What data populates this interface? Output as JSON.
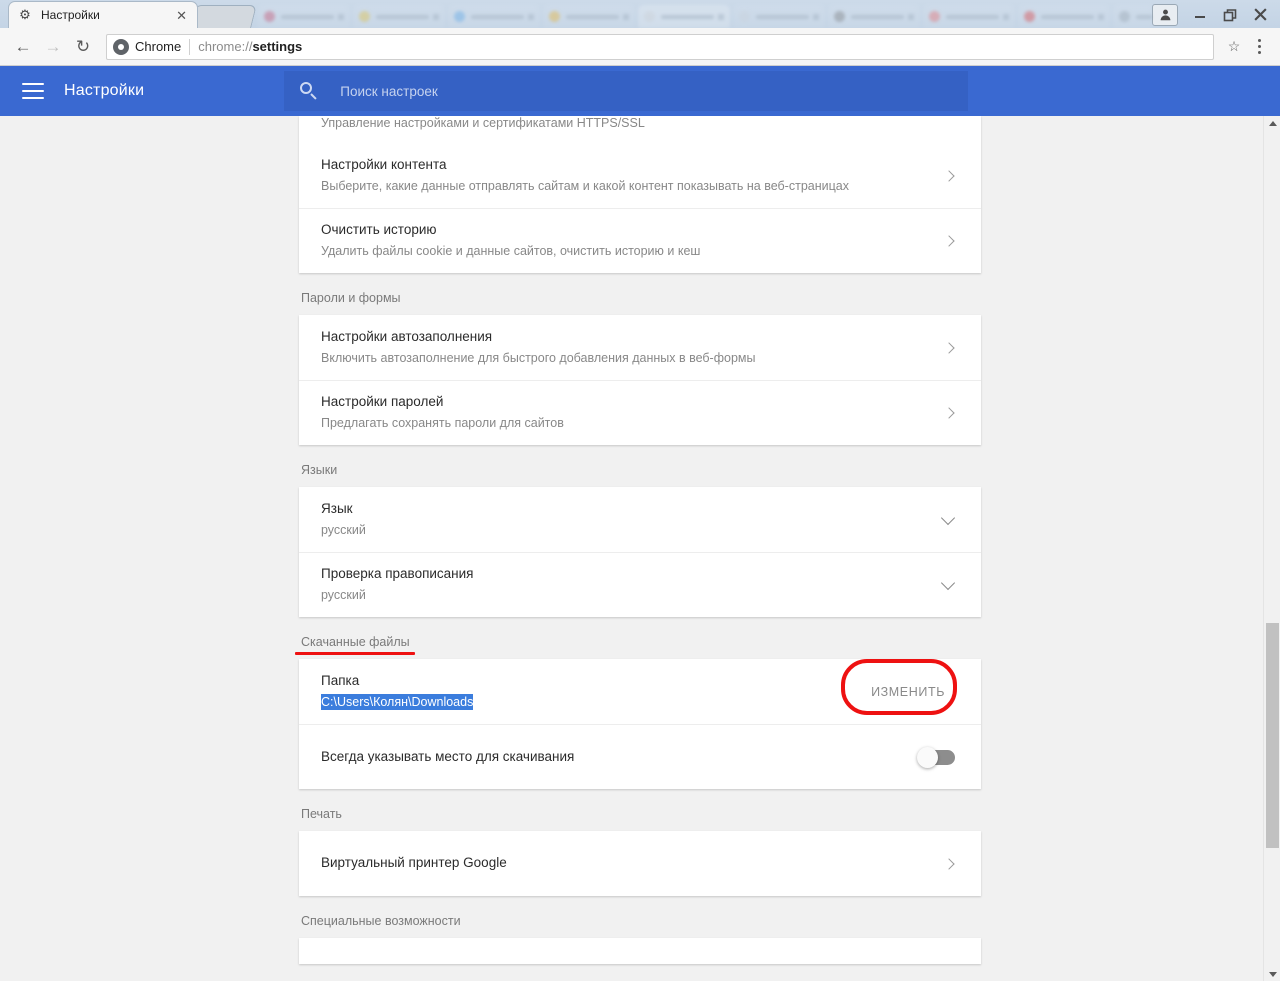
{
  "window": {
    "tab": {
      "title": "Настройки",
      "favicon_icon": "gear-icon",
      "close_icon": "close-icon"
    },
    "new_tab_icon": "new-tab-icon",
    "controls": {
      "profile_icon": "person-icon",
      "minimize_icon": "minimize-icon",
      "maximize_icon": "maximize-icon",
      "close_icon": "window-close-icon"
    }
  },
  "toolbar": {
    "back_icon": "arrow-left-icon",
    "forward_icon": "arrow-right-icon",
    "reload_icon": "reload-icon",
    "omnibox": {
      "chrome_icon": "chrome-icon",
      "scheme_label": "Chrome",
      "url_prefix": "chrome://",
      "url_bold": "settings"
    },
    "bookmark_icon": "star-icon",
    "menu_icon": "three-dots-icon"
  },
  "settings_header": {
    "menu_icon": "hamburger-icon",
    "title": "Настройки",
    "search": {
      "icon": "search-icon",
      "placeholder": "Поиск настроек"
    },
    "accent_color": "#3a69d1",
    "search_bg_color": "#3561c4"
  },
  "content": {
    "partial_top_row": {
      "subtitle": "Управление настройками и сертификатами HTTPS/SSL"
    },
    "privacy_rows": [
      {
        "title": "Настройки контента",
        "subtitle": "Выберите, какие данные отправлять сайтам и какой контент показывать на веб-страницах",
        "chevron_icon": "chevron-right-icon"
      },
      {
        "title": "Очистить историю",
        "subtitle": "Удалить файлы cookie и данные сайтов, очистить историю и кеш",
        "chevron_icon": "chevron-right-icon"
      }
    ],
    "sections": [
      {
        "label": "Пароли и формы",
        "rows": [
          {
            "title": "Настройки автозаполнения",
            "subtitle": "Включить автозаполнение для быстрого добавления данных в веб-формы",
            "chevron_icon": "chevron-right-icon"
          },
          {
            "title": "Настройки паролей",
            "subtitle": "Предлагать сохранять пароли для сайтов",
            "chevron_icon": "chevron-right-icon"
          }
        ]
      },
      {
        "label": "Языки",
        "rows": [
          {
            "title": "Язык",
            "subtitle": "русский",
            "chevron_icon": "chevron-down-icon"
          },
          {
            "title": "Проверка правописания",
            "subtitle": "русский",
            "chevron_icon": "chevron-down-icon"
          }
        ]
      }
    ],
    "downloads": {
      "label": "Скачанные файлы",
      "label_underline_color": "#ee1111",
      "folder_title": "Папка",
      "folder_path": "C:\\Users\\Колян\\Downloads",
      "folder_path_selected": true,
      "selection_color": "#3b7ddd",
      "change_button": "ИЗМЕНИТЬ",
      "change_button_highlight_color": "#ee1111",
      "ask_location_title": "Всегда указывать место для скачивания",
      "ask_location_toggle_on": false
    },
    "printing": {
      "label": "Печать",
      "rows": [
        {
          "title": "Виртуальный принтер Google",
          "chevron_icon": "chevron-right-icon"
        }
      ]
    },
    "accessibility": {
      "label": "Специальные возможности"
    },
    "scrollbar": {
      "up_arrow_icon": "scroll-up-icon",
      "down_arrow_icon": "scroll-down-icon"
    }
  }
}
